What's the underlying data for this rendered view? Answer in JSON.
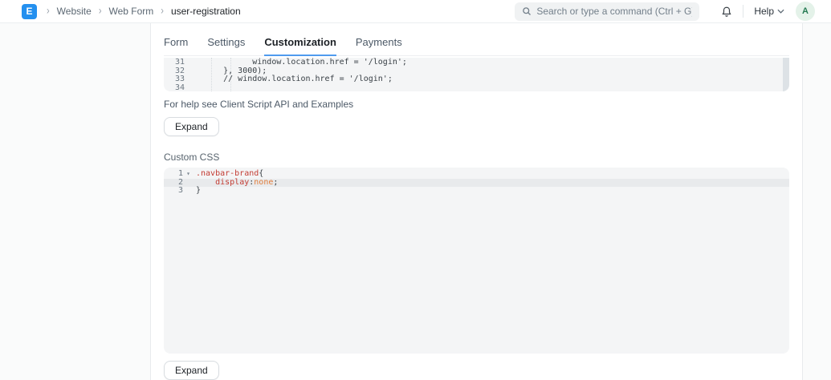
{
  "colors": {
    "brand_blue": "#2490ef",
    "tab_underline": "#4f9bee",
    "avatar_bg": "#e4f2e9",
    "avatar_text": "#247a52",
    "css_selector_red": "#c33c33",
    "css_value_orange": "#e07b39",
    "editor_bg": "#f4f5f6"
  },
  "navbar": {
    "logo_letter": "E",
    "breadcrumb": {
      "items": [
        "Website",
        "Web Form",
        "user-registration"
      ]
    },
    "search": {
      "placeholder": "Search or type a command (Ctrl + G)"
    },
    "help_label": "Help",
    "avatar_letter": "A"
  },
  "tabs": {
    "items": [
      {
        "label": "Form"
      },
      {
        "label": "Settings"
      },
      {
        "label": "Customization"
      },
      {
        "label": "Payments"
      }
    ],
    "active": "Customization"
  },
  "client_script": {
    "lines": [
      {
        "num": "31",
        "code": "            window.location.href = '/login';"
      },
      {
        "num": "32",
        "code": "      }, 3000);"
      },
      {
        "num": "33",
        "code": "      // window.location.href = '/login';"
      },
      {
        "num": "34",
        "code": ""
      }
    ],
    "help_text": "For help see Client Script API and Examples",
    "expand_label": "Expand"
  },
  "custom_css": {
    "label": "Custom CSS",
    "fold_caret": "▾",
    "lines": [
      {
        "num": "1"
      },
      {
        "num": "2"
      },
      {
        "num": "3"
      }
    ],
    "tokens": {
      "line1_selector": ".navbar-brand",
      "line1_brace": "{",
      "line2_indent": "    ",
      "line2_property": "display",
      "line2_colon": ":",
      "line2_value": "none",
      "line2_semicolon": ";",
      "line3_brace": "}"
    },
    "expand_label": "Expand"
  }
}
